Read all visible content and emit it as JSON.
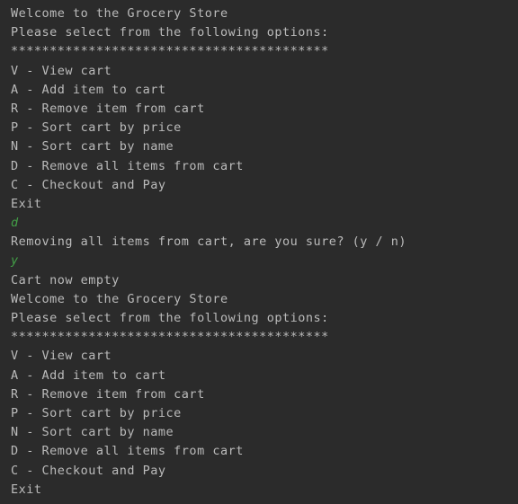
{
  "console": {
    "output_color": "#bbbbbb",
    "input_color": "#43a047",
    "background": "#2b2b2b",
    "lines": [
      {
        "text": "Welcome to the Grocery Store",
        "kind": "output"
      },
      {
        "text": "Please select from the following options:",
        "kind": "output"
      },
      {
        "text": "*****************************************",
        "kind": "output"
      },
      {
        "text": "V - View cart",
        "kind": "output"
      },
      {
        "text": "A - Add item to cart",
        "kind": "output"
      },
      {
        "text": "R - Remove item from cart",
        "kind": "output"
      },
      {
        "text": "P - Sort cart by price",
        "kind": "output"
      },
      {
        "text": "N - Sort cart by name",
        "kind": "output"
      },
      {
        "text": "D - Remove all items from cart",
        "kind": "output"
      },
      {
        "text": "C - Checkout and Pay",
        "kind": "output"
      },
      {
        "text": "Exit",
        "kind": "output"
      },
      {
        "text": "d",
        "kind": "input"
      },
      {
        "text": "Removing all items from cart, are you sure? (y / n)",
        "kind": "output"
      },
      {
        "text": "y",
        "kind": "input"
      },
      {
        "text": "Cart now empty",
        "kind": "output"
      },
      {
        "text": "Welcome to the Grocery Store",
        "kind": "output"
      },
      {
        "text": "Please select from the following options:",
        "kind": "output"
      },
      {
        "text": "*****************************************",
        "kind": "output"
      },
      {
        "text": "V - View cart",
        "kind": "output"
      },
      {
        "text": "A - Add item to cart",
        "kind": "output"
      },
      {
        "text": "R - Remove item from cart",
        "kind": "output"
      },
      {
        "text": "P - Sort cart by price",
        "kind": "output"
      },
      {
        "text": "N - Sort cart by name",
        "kind": "output"
      },
      {
        "text": "D - Remove all items from cart",
        "kind": "output"
      },
      {
        "text": "C - Checkout and Pay",
        "kind": "output"
      },
      {
        "text": "Exit",
        "kind": "output"
      }
    ]
  }
}
